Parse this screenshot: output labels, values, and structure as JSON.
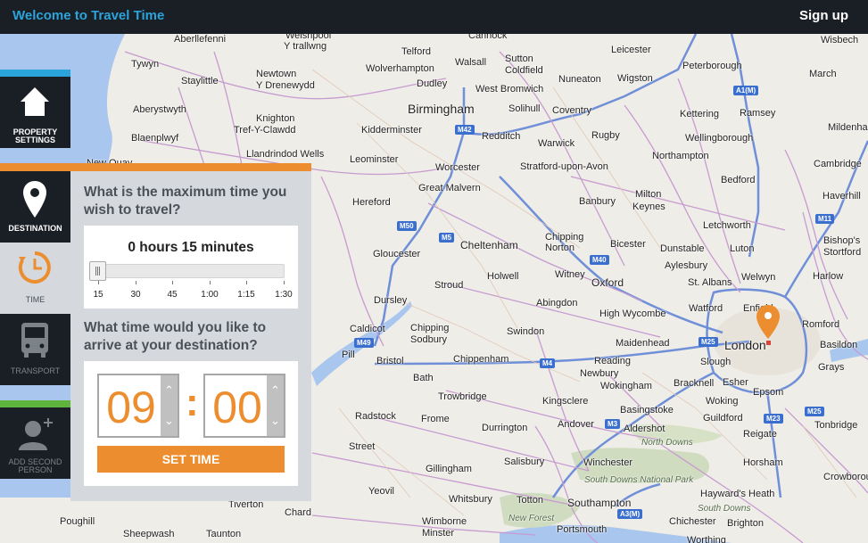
{
  "header": {
    "brand": "Welcome to Travel Time",
    "signup": "Sign up"
  },
  "nav": {
    "property": "PROPERTY SETTINGS",
    "destination": "DESTINATION",
    "time": "TIME",
    "transport": "TRANSPORT",
    "second_person": "ADD SECOND PERSON"
  },
  "panel": {
    "question_travel": "What is the maximum time you wish to travel?",
    "duration": "0 hours 15 minutes",
    "duration_value_minutes": 15,
    "tick_labels": [
      "15",
      "30",
      "45",
      "1:00",
      "1:15",
      "1:30"
    ],
    "question_arrive": "What time would you like to arrive at your destination?",
    "hours": "09",
    "minutes": "00",
    "colon": ":",
    "set_time": "SET TIME"
  },
  "colors": {
    "accent": "#ec8e2f",
    "brand": "#2ba3db",
    "dark": "#1a1f25"
  },
  "map": {
    "places": [
      "Aberllefenni",
      "Welshpool",
      "Y trallwng",
      "Telford",
      "Cannock",
      "Leicester",
      "Wisbech",
      "Tywyn",
      "Wolverhampton",
      "Walsall",
      "Sutton",
      "Coldfield",
      "Peterborough",
      "Staylittle",
      "Newtown",
      "Y Drenewydd",
      "Dudley",
      "West Bromwich",
      "Nuneaton",
      "Wigston",
      "March",
      "Aberystwyth",
      "Birmingham",
      "Solihull",
      "Coventry",
      "Kettering",
      "Ramsey",
      "Knighton",
      "Tref-Y-Clawdd",
      "Kidderminster",
      "Redditch",
      "Rugby",
      "Mildenhall",
      "Blaenplwyf",
      "Wellingborough",
      "Llandrindod Wells",
      "Warwick",
      "New Quay",
      "Leominster",
      "Northampton",
      "Cambridge",
      "Worcester",
      "Stratford-upon-Avon",
      "Bedford",
      "Great Malvern",
      "Milton",
      "Keynes",
      "Haverhill",
      "Hereford",
      "Banbury",
      "Letchworth",
      "Bishop's",
      "Stortford",
      "Cheltenham",
      "Chipping",
      "Norton",
      "Bicester",
      "Dunstable",
      "Luton",
      "Gloucester",
      "Aylesbury",
      "Welwyn",
      "Stroud",
      "Holwell",
      "Witney",
      "Oxford",
      "St. Albans",
      "Harlow",
      "Dursley",
      "Abingdon",
      "High Wycombe",
      "Watford",
      "Enfield",
      "Caldicot",
      "Chipping",
      "Sodbury",
      "Swindon",
      "Maidenhead",
      "London",
      "Romford",
      "Pill",
      "Bristol",
      "Chippenham",
      "Reading",
      "Slough",
      "Basildon",
      "Newbury",
      "Wokingham",
      "Bracknell",
      "Esher",
      "Grays",
      "Bath",
      "Trowbridge",
      "Kingsclere",
      "Epsom",
      "Radstock",
      "Frome",
      "Basingstoke",
      "Woking",
      "Andover",
      "Aldershot",
      "Guildford",
      "Tonbridge",
      "Durrington",
      "North Downs",
      "Reigate",
      "Street",
      "Salisbury",
      "Winchester",
      "Horsham",
      "Gillingham",
      "South Downs National Park",
      "Crowborough",
      "Yeovil",
      "Whitsbury",
      "Totton",
      "Southampton",
      "Hayward's Heath",
      "Poughill",
      "Tiverton",
      "Chard",
      "New Forest",
      "South Downs",
      "Wimborne",
      "Minster",
      "Portsmouth",
      "Chichester",
      "Brighton",
      "Sheepwash",
      "Taunton",
      "Worthing"
    ],
    "roads": [
      "M42",
      "M50",
      "M5",
      "M40",
      "M49",
      "M4",
      "M3",
      "M25",
      "M23",
      "A1(M)",
      "M11",
      "A3(M)"
    ]
  }
}
